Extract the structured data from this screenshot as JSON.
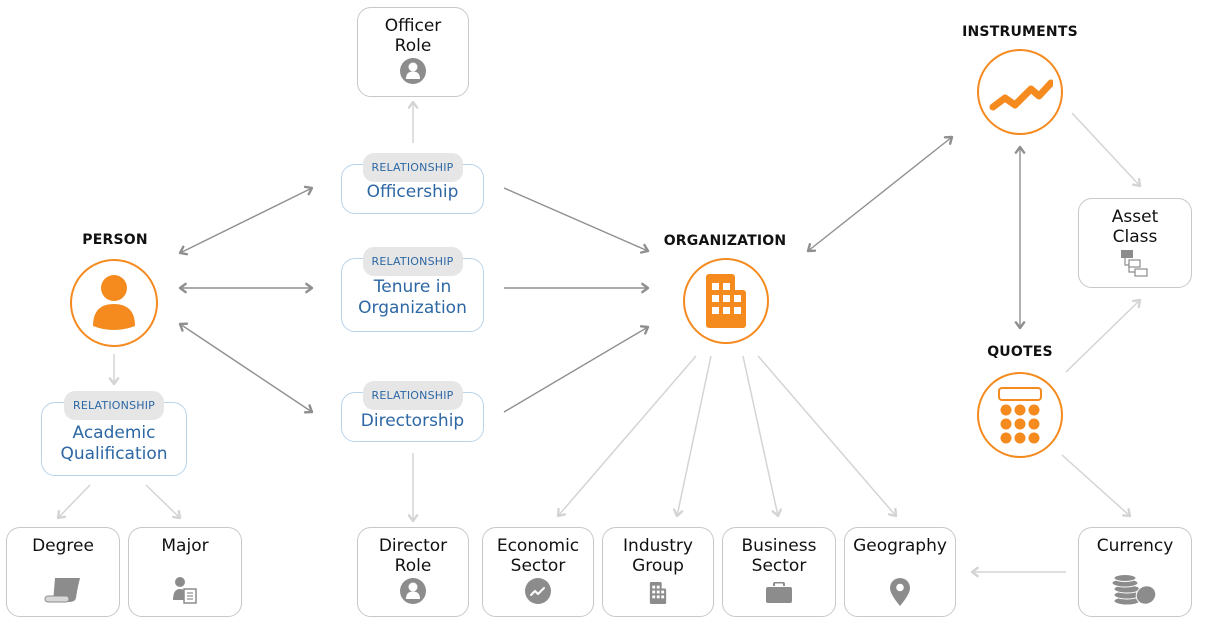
{
  "colors": {
    "accent": "#f58a1f",
    "relationship_text": "#2d67a4",
    "relationship_border": "#b9d4ea",
    "leaf_border": "#c8c8c8",
    "icon_gray": "#8c8c8c",
    "edge_dark": "#8f8f8f",
    "edge_light": "#d4d4d4"
  },
  "hubs": {
    "person": {
      "label": "PERSON",
      "icon": "person-icon"
    },
    "organization": {
      "label": "ORGANIZATION",
      "icon": "building-icon"
    },
    "instruments": {
      "label": "INSTRUMENTS",
      "icon": "trend-line-icon"
    },
    "quotes": {
      "label": "QUOTES",
      "icon": "calculator-icon"
    }
  },
  "relationships": {
    "tag": "RELATIONSHIP",
    "officership": "Officership",
    "tenure": "Tenure in\nOrganization",
    "directorship": "Directorship",
    "academic": "Academic\nQualification"
  },
  "leaves": {
    "officer_role": {
      "label": "Officer\nRole",
      "icon": "user-circle-icon"
    },
    "director_role": {
      "label": "Director\nRole",
      "icon": "user-circle-icon"
    },
    "degree": {
      "label": "Degree",
      "icon": "scroll-icon"
    },
    "major": {
      "label": "Major",
      "icon": "user-document-icon"
    },
    "economic_sector": {
      "label": "Economic\nSector",
      "icon": "chart-circle-icon"
    },
    "industry_group": {
      "label": "Industry\nGroup",
      "icon": "building-icon"
    },
    "business_sector": {
      "label": "Business\nSector",
      "icon": "briefcase-icon"
    },
    "geography": {
      "label": "Geography",
      "icon": "map-pin-icon"
    },
    "asset_class": {
      "label": "Asset\nClass",
      "icon": "hierarchy-icon"
    },
    "currency": {
      "label": "Currency",
      "icon": "coins-icon"
    }
  },
  "edges": [
    {
      "from": "person",
      "to": "officership",
      "style": "dark",
      "bidirectional": true
    },
    {
      "from": "person",
      "to": "tenure",
      "style": "dark",
      "bidirectional": true
    },
    {
      "from": "person",
      "to": "directorship",
      "style": "dark",
      "bidirectional": true
    },
    {
      "from": "officership",
      "to": "organization",
      "style": "dark",
      "bidirectional": false
    },
    {
      "from": "tenure",
      "to": "organization",
      "style": "dark",
      "bidirectional": false
    },
    {
      "from": "directorship",
      "to": "organization",
      "style": "dark",
      "bidirectional": false
    },
    {
      "from": "organization",
      "to": "instruments",
      "style": "dark",
      "bidirectional": true
    },
    {
      "from": "instruments",
      "to": "quotes",
      "style": "dark",
      "bidirectional": true
    },
    {
      "from": "officership",
      "to": "officer_role",
      "style": "light",
      "bidirectional": false
    },
    {
      "from": "directorship",
      "to": "director_role",
      "style": "light",
      "bidirectional": false
    },
    {
      "from": "person",
      "to": "academic",
      "style": "light",
      "bidirectional": false
    },
    {
      "from": "academic",
      "to": "degree",
      "style": "light",
      "bidirectional": false
    },
    {
      "from": "academic",
      "to": "major",
      "style": "light",
      "bidirectional": false
    },
    {
      "from": "organization",
      "to": "economic_sector",
      "style": "light",
      "bidirectional": false
    },
    {
      "from": "organization",
      "to": "industry_group",
      "style": "light",
      "bidirectional": false
    },
    {
      "from": "organization",
      "to": "business_sector",
      "style": "light",
      "bidirectional": false
    },
    {
      "from": "organization",
      "to": "geography",
      "style": "light",
      "bidirectional": false
    },
    {
      "from": "instruments",
      "to": "asset_class",
      "style": "light",
      "bidirectional": false
    },
    {
      "from": "quotes",
      "to": "asset_class",
      "style": "light",
      "bidirectional": false
    },
    {
      "from": "quotes",
      "to": "currency",
      "style": "light",
      "bidirectional": false
    },
    {
      "from": "currency",
      "to": "geography",
      "style": "light",
      "bidirectional": false
    }
  ]
}
